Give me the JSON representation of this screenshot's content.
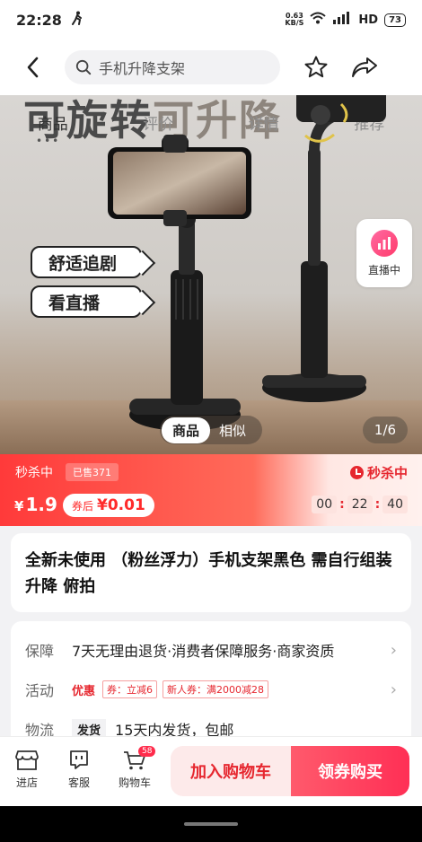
{
  "status_bar": {
    "time": "22:28",
    "activity_icon": "walking-icon",
    "net_speed_value": "0.63",
    "net_speed_unit": "KB/S",
    "network": "HD",
    "battery": "73"
  },
  "header": {
    "search_value": "手机升降支架",
    "icons": [
      "back-icon",
      "search-icon",
      "star-icon",
      "share-icon"
    ]
  },
  "hero": {
    "slogan_dark": "可旋转",
    "slogan_muted": "可升降",
    "tabs": [
      "商品",
      "评价",
      "详情",
      "推荐"
    ],
    "active_tab": "商品",
    "pill_1": "舒适追剧",
    "pill_2": "看直播",
    "live_label": "直播中",
    "view_on": "商品",
    "view_off": "相似",
    "page_indicator": "1/6"
  },
  "flash_sale": {
    "label": "秒杀中",
    "sold": "已售371",
    "price_symbol": "¥",
    "price": "1.9",
    "coupon_label": "券后",
    "coupon_price": "¥0.01",
    "right_label": "秒杀中",
    "countdown": {
      "hours": "00",
      "minutes": "22",
      "seconds": "40"
    }
  },
  "product": {
    "title": "全新未使用 （粉丝浮力）手机支架黑色 需自行组装 升降 俯拍"
  },
  "info": {
    "guarantee_label": "保障",
    "guarantee_text": "7天无理由退货·消费者保障服务·商家资质",
    "activity_label": "活动",
    "activity_strong": "优惠",
    "coupon_tag_1": "券：立减6",
    "coupon_tag_2": "新人券：满2000减28",
    "shipping_label": "物流",
    "shipping_tag": "发货",
    "shipping_text": "15天内发货，包邮"
  },
  "bottom_bar": {
    "store": "进店",
    "service": "客服",
    "cart": "购物车",
    "cart_count": "58",
    "add_to_cart": "加入购物车",
    "buy_now": "领券购买"
  },
  "colors": {
    "accent": "#e6272f",
    "buy_button": "#ff2f55",
    "live_badge": "#ff3b6b"
  }
}
